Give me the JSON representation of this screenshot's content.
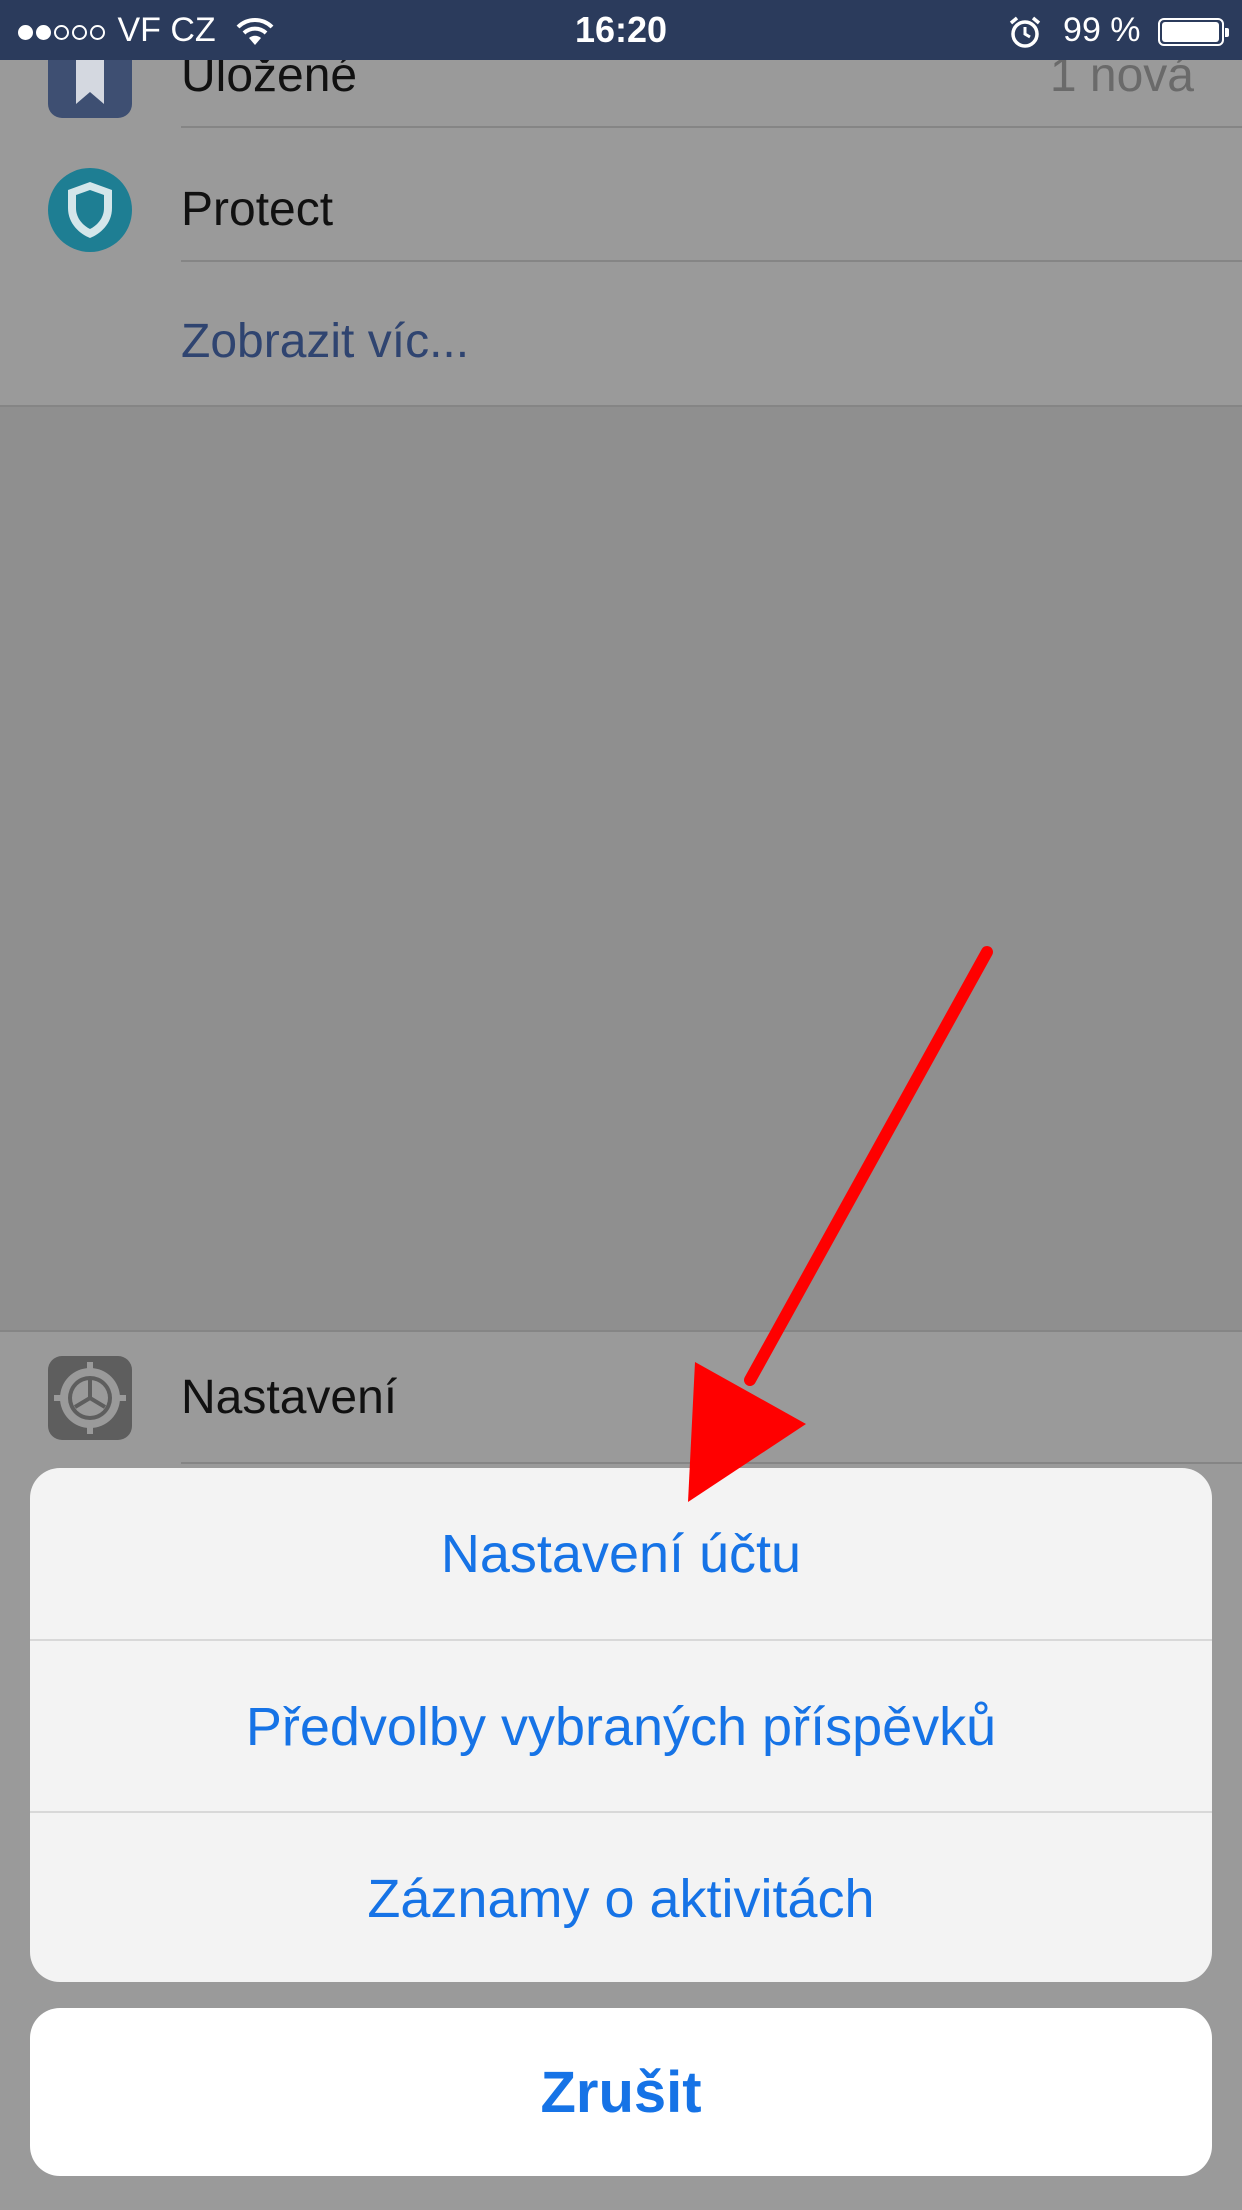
{
  "status_bar": {
    "carrier": "VF CZ",
    "signal_bars_filled": 2,
    "signal_bars_total": 5,
    "time": "16:20",
    "battery_percent": "99 %",
    "battery_level": 0.99
  },
  "menu": {
    "items": [
      {
        "label": "Uložené",
        "badge": "1 nová",
        "icon": "bookmark-icon"
      },
      {
        "label": "Protect",
        "icon": "shield-icon"
      }
    ],
    "show_more": "Zobrazit víc...",
    "settings": {
      "label": "Nastavení",
      "icon": "gear-icon"
    }
  },
  "action_sheet": {
    "options": [
      "Nastavení účtu",
      "Předvolby vybraných příspěvků",
      "Záznamy o aktivitách"
    ],
    "cancel": "Zrušit"
  },
  "colors": {
    "status_bar_bg": "#2b3b5c",
    "action_blue": "#1673e6",
    "annotation_arrow": "#ff0000",
    "protect_icon": "#1a8ca8",
    "bookmark_icon": "#3b5998"
  }
}
